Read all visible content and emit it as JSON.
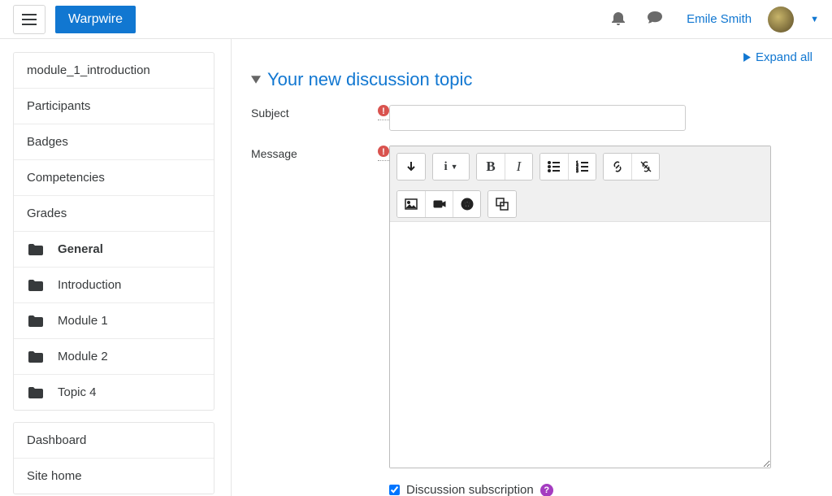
{
  "header": {
    "brand": "Warpwire",
    "user_name": "Emile Smith"
  },
  "sidebar": {
    "panel1": [
      {
        "label": "module_1_introduction",
        "folder": false,
        "active": false
      },
      {
        "label": "Participants",
        "folder": false,
        "active": false
      },
      {
        "label": "Badges",
        "folder": false,
        "active": false
      },
      {
        "label": "Competencies",
        "folder": false,
        "active": false
      },
      {
        "label": "Grades",
        "folder": false,
        "active": false
      },
      {
        "label": "General",
        "folder": true,
        "active": true
      },
      {
        "label": "Introduction",
        "folder": true,
        "active": false
      },
      {
        "label": "Module 1",
        "folder": true,
        "active": false
      },
      {
        "label": "Module 2",
        "folder": true,
        "active": false
      },
      {
        "label": "Topic 4",
        "folder": true,
        "active": false
      }
    ],
    "panel2": [
      {
        "label": "Dashboard"
      },
      {
        "label": "Site home"
      }
    ]
  },
  "main": {
    "expand_all": "Expand all",
    "section_title": "Your new discussion topic",
    "subject_label": "Subject",
    "message_label": "Message",
    "subject_value": "",
    "message_value": "",
    "subscription_label": "Discussion subscription",
    "subscription_checked": true
  },
  "toolbar_icons": {
    "row1": [
      "arrow-down",
      "info-dropdown",
      "bold",
      "italic",
      "bullet-list",
      "number-list",
      "link",
      "unlink"
    ],
    "row2": [
      "image",
      "video",
      "warpwire",
      "embed"
    ]
  }
}
